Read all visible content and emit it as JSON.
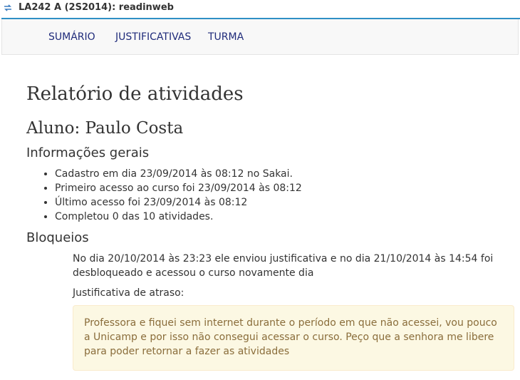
{
  "window": {
    "title": "LA242 A (2S2014): readinweb",
    "icon": "sync-arrows-icon"
  },
  "colors": {
    "accent": "#2f8fc5",
    "nav_link": "#1f2b7a",
    "alert_bg": "#fcf8e3",
    "alert_border": "#faebcc",
    "alert_text": "#8a6d3b"
  },
  "nav": {
    "items": [
      {
        "label": "SUMÁRIO"
      },
      {
        "label": "JUSTIFICATIVAS"
      },
      {
        "label": "TURMA"
      }
    ]
  },
  "page": {
    "title": "Relatório de atividades",
    "student": "Aluno: Paulo Costa",
    "general_heading": "Informações gerais",
    "general_items": [
      "Cadastro em dia 23/09/2014 às 08:12 no Sakai.",
      "Primeiro acesso ao curso foi 23/09/2014 às 08:12",
      "Último acesso foi 23/09/2014 às 08:12",
      "Completou 0 das 10 atividades."
    ],
    "blocks_heading": "Bloqueios",
    "block_text": "No dia 20/10/2014 às 23:23 ele enviou justificativa e no dia 21/10/2014 às 14:54 foi desbloqueado e acessou o curso novamente dia",
    "justification_label": "Justificativa de atraso:",
    "justification_text": "Professora e fiquei sem internet durante o período em que não acessei, vou pouco a Unicamp e por isso não consegui acessar o curso. Peço que a senhora me libere para poder retornar a fazer as atividades"
  }
}
